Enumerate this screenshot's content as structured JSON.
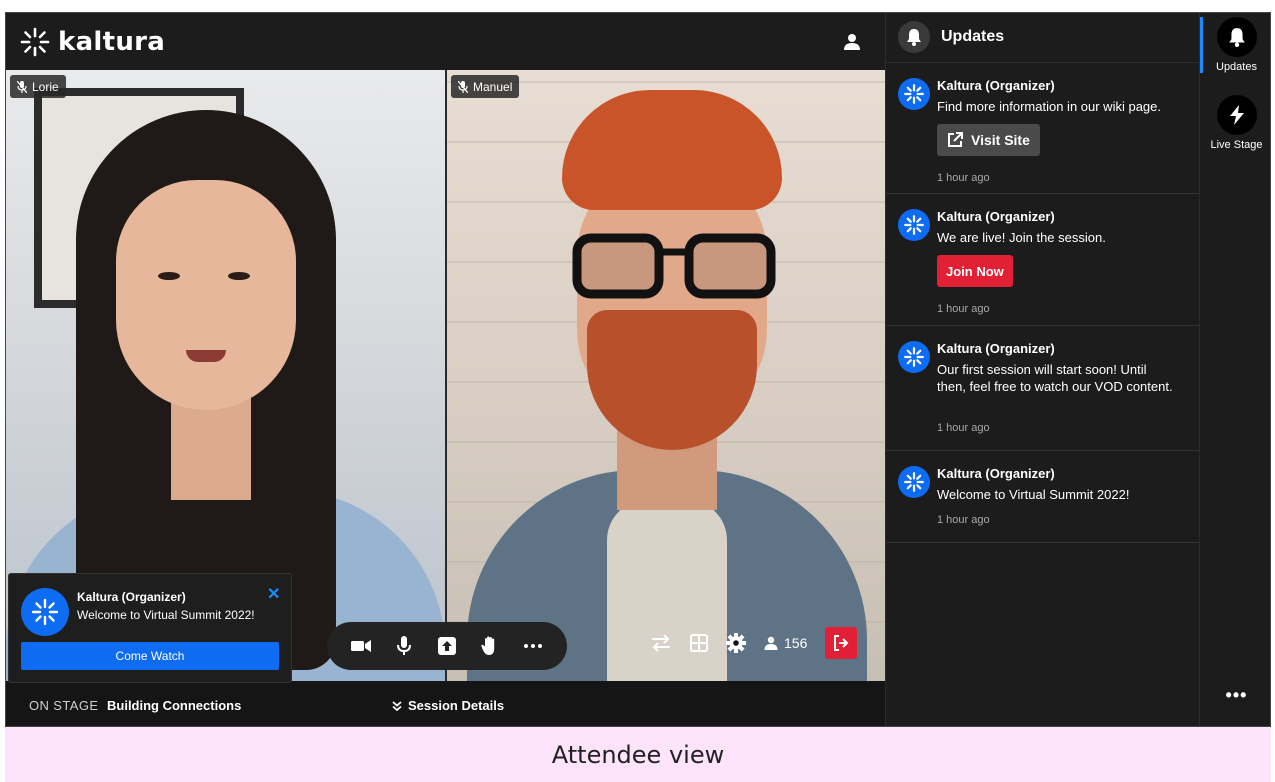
{
  "app": {
    "logo_text": "kaltura",
    "brand_color": "#0e6cf3",
    "danger_color": "#e12035"
  },
  "stage": {
    "participants": [
      {
        "name": "Lorie",
        "mic": "muted"
      },
      {
        "name": "Manuel",
        "mic": "muted"
      }
    ],
    "controls": [
      "camera-icon",
      "microphone-icon",
      "share-screen-icon",
      "raise-hand-icon",
      "more-options-icon"
    ],
    "right_controls": [
      "switch-layout-icon",
      "grid-view-icon",
      "settings-gear-icon"
    ],
    "viewer_count": "156",
    "on_stage_label": "ON STAGE",
    "session_name": "Building Connections",
    "session_details_label": "Session Details"
  },
  "toast": {
    "title": "Kaltura (Organizer)",
    "body": "Welcome to Virtual Summit 2022!",
    "button": "Come Watch",
    "close": "✕"
  },
  "updates": {
    "title": "Updates",
    "items": [
      {
        "author": "Kaltura (Organizer)",
        "body": "Find more information in our wiki page.",
        "button": "Visit Site",
        "time": "1 hour ago"
      },
      {
        "author": "Kaltura (Organizer)",
        "body": "We are live! Join the session.",
        "button": "Join Now",
        "time": "1 hour ago"
      },
      {
        "author": "Kaltura (Organizer)",
        "body": "Our first session will start soon! Until then, feel free to watch our VOD content.",
        "time": "1 hour ago"
      },
      {
        "author": "Kaltura (Organizer)",
        "body": "Welcome to Virtual Summit 2022!",
        "time": "1 hour ago"
      }
    ]
  },
  "rail": {
    "items": [
      {
        "label": "Updates",
        "icon": "bell-icon",
        "active": true
      },
      {
        "label": "Live Stage",
        "icon": "lightning-icon",
        "active": false
      }
    ],
    "more": "•••"
  },
  "caption": "Attendee view"
}
